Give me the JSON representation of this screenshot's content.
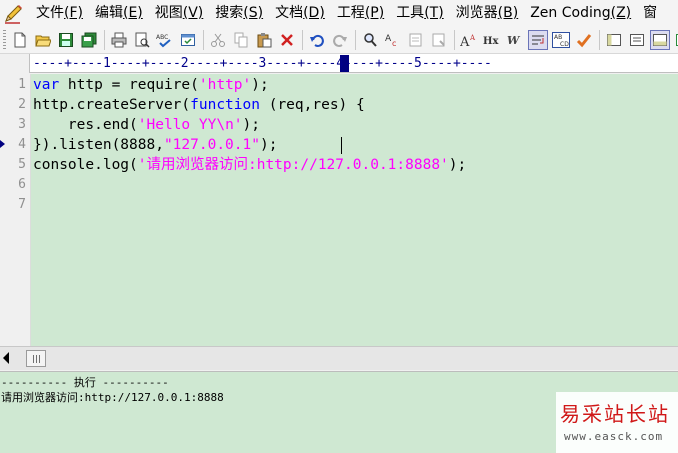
{
  "menu": [
    {
      "label": "文件",
      "key": "(F)"
    },
    {
      "label": "编辑",
      "key": "(E)"
    },
    {
      "label": "视图",
      "key": "(V)"
    },
    {
      "label": "搜索",
      "key": "(S)"
    },
    {
      "label": "文档",
      "key": "(D)"
    },
    {
      "label": "工程",
      "key": "(P)"
    },
    {
      "label": "工具",
      "key": "(T)"
    },
    {
      "label": "浏览器",
      "key": "(B)"
    },
    {
      "label": "Zen Coding",
      "key": "(Z)"
    },
    {
      "label": "窗",
      "key": ""
    }
  ],
  "toolbar": {
    "glyphs": {
      "find": "⌕",
      "replace": "A̶c",
      "font_size": "AA",
      "heading": "Hx",
      "italic": "W",
      "wrap": "↵",
      "abc": "ABC",
      "check": "✔",
      "spell": "ABC"
    }
  },
  "ruler": {
    "text": "----+----1----+----2----+----3----+----4----+----5----+----"
  },
  "editor": {
    "line_numbers": [
      "1",
      "2",
      "3",
      "4",
      "5",
      "6",
      "7"
    ],
    "lines": [
      [
        {
          "t": "var",
          "c": "kw"
        },
        {
          "t": " http = require(",
          "c": ""
        },
        {
          "t": "'http'",
          "c": "str"
        },
        {
          "t": ");",
          "c": ""
        }
      ],
      [
        {
          "t": "http.createServer(",
          "c": ""
        },
        {
          "t": "function",
          "c": "kw"
        },
        {
          "t": " (req,res) {",
          "c": ""
        }
      ],
      [
        {
          "t": "    res.end(",
          "c": ""
        },
        {
          "t": "'Hello YY\\n'",
          "c": "str"
        },
        {
          "t": ");",
          "c": ""
        }
      ],
      [
        {
          "t": "}).listen(8888,",
          "c": ""
        },
        {
          "t": "\"127.0.0.1\"",
          "c": "str"
        },
        {
          "t": ");",
          "c": ""
        }
      ],
      [
        {
          "t": "console.log(",
          "c": ""
        },
        {
          "t": "'请用浏览器访问:http://127.0.0.1:8888'",
          "c": "str"
        },
        {
          "t": ");",
          "c": ""
        }
      ],
      [],
      []
    ],
    "current_line": 4
  },
  "output": {
    "header": "---------- 执行 ----------",
    "text": "请用浏览器访问:http://127.0.0.1:8888"
  },
  "watermark": {
    "title": "易采站长站",
    "url": "www.easck.com"
  },
  "colors": {
    "editor_bg": "#cfe8d2",
    "keyword": "#0000ff",
    "string": "#ff00ff",
    "ruler": "#00008b",
    "watermark": "#d01818"
  }
}
